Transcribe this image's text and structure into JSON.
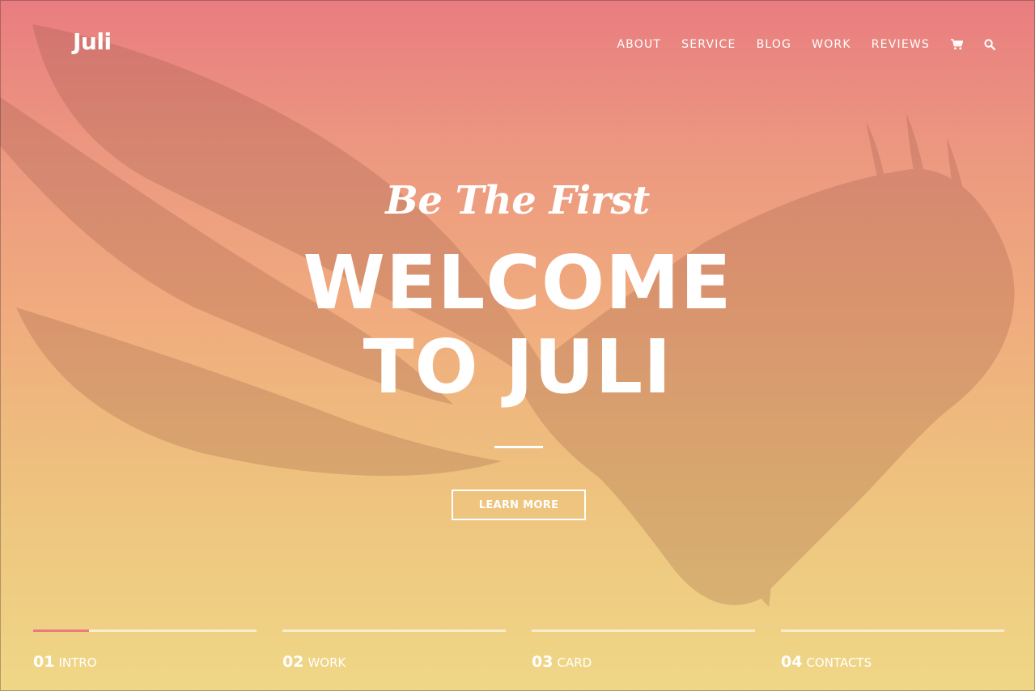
{
  "header": {
    "logo": "Juli",
    "nav": [
      {
        "label": "ABOUT"
      },
      {
        "label": "SERVICE"
      },
      {
        "label": "BLOG"
      },
      {
        "label": "WORK"
      },
      {
        "label": "REVIEWS"
      }
    ],
    "icons": [
      "cart-icon",
      "search-icon"
    ]
  },
  "hero": {
    "tagline": "Be The First",
    "headline_line1": "WELCOME",
    "headline_line2": "TO JULI",
    "cta_label": "LEARN MORE"
  },
  "slides": [
    {
      "number": "01",
      "label": "INTRO",
      "progress": 0.25
    },
    {
      "number": "02",
      "label": "WORK",
      "progress": 0
    },
    {
      "number": "03",
      "label": "CARD",
      "progress": 0
    },
    {
      "number": "04",
      "label": "CONTACTS",
      "progress": 0
    }
  ],
  "colors": {
    "accent": "#e97b7f",
    "gradient_top": "#e97d80",
    "gradient_bottom": "#efd786"
  }
}
